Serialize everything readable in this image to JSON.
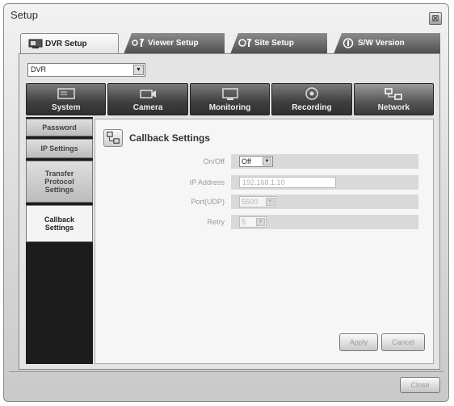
{
  "window": {
    "title": "Setup",
    "close_glyph": "⊠"
  },
  "tabs": [
    {
      "label": "DVR Setup",
      "icon": "dvr-icon"
    },
    {
      "label": "Viewer Setup",
      "icon": "viewer-tools-icon"
    },
    {
      "label": "Site Setup",
      "icon": "site-tools-icon"
    },
    {
      "label": "S/W Version",
      "icon": "info-icon"
    }
  ],
  "dvr_select": {
    "value": "DVR",
    "arrow": "▼"
  },
  "categories": [
    {
      "label": "System",
      "icon": "system-icon"
    },
    {
      "label": "Camera",
      "icon": "camera-icon"
    },
    {
      "label": "Monitoring",
      "icon": "monitor-icon"
    },
    {
      "label": "Recording",
      "icon": "recording-icon"
    },
    {
      "label": "Network",
      "icon": "network-icon"
    }
  ],
  "sidebar": {
    "items": [
      {
        "label": "Password"
      },
      {
        "label": "IP Settings"
      },
      {
        "label": "Transfer Protocol Settings"
      },
      {
        "label": "Callback Settings"
      }
    ]
  },
  "panel": {
    "title": "Callback Settings",
    "icon": "callback-settings-icon",
    "fields": {
      "onoff": {
        "label": "On/Off",
        "value": "Off",
        "arrow": "▼"
      },
      "ip": {
        "label": "IP Address",
        "value": "192.168.1.10"
      },
      "port": {
        "label": "Port(UDP)",
        "value": "5500",
        "arrow": "▼"
      },
      "retry": {
        "label": "Retry",
        "value": "5",
        "arrow": "▼"
      }
    },
    "buttons": {
      "apply": "Apply",
      "cancel": "Cancel"
    }
  },
  "footer": {
    "close_label": "Close"
  }
}
